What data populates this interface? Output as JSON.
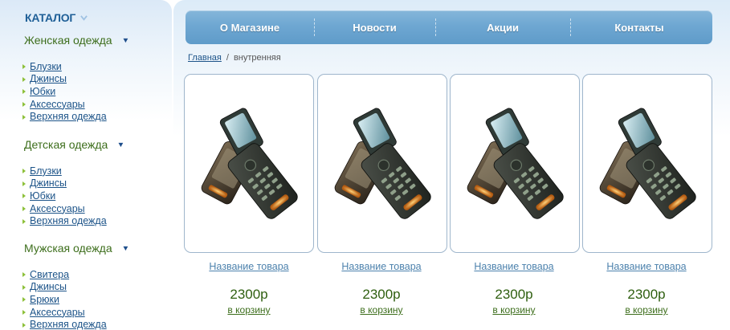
{
  "sidebar": {
    "catalog_title": "КАТАЛОГ",
    "sections": [
      {
        "title": "Женская одежда",
        "items": [
          "Блузки",
          "Джинсы",
          "Юбки",
          "Аксессуары",
          "Верхняя одежда"
        ]
      },
      {
        "title": "Детская одежда",
        "items": [
          "Блузки",
          "Джинсы",
          "Юбки",
          "Аксессуары",
          "Верхняя одежда"
        ]
      },
      {
        "title": "Мужская одежда",
        "items": [
          "Свитера",
          "Джинсы",
          "Брюки",
          "Аксессуары",
          "Верхняя одежда"
        ]
      }
    ]
  },
  "nav": {
    "items": [
      "О Магазине",
      "Новости",
      "Акции",
      "Контакты"
    ]
  },
  "breadcrumb": {
    "home": "Главная",
    "separator": "/",
    "current": "внутренняя"
  },
  "products": [
    {
      "name": "Название товара",
      "price": "2300р",
      "cart": "в корзину",
      "icon": "flip-phone-image"
    },
    {
      "name": "Название товара",
      "price": "2300р",
      "cart": "в корзину",
      "icon": "flip-phone-image"
    },
    {
      "name": "Название товара",
      "price": "2300р",
      "cart": "в корзину",
      "icon": "flip-phone-image"
    },
    {
      "name": "Название товара",
      "price": "2300р",
      "cart": "в корзину",
      "icon": "flip-phone-image"
    }
  ],
  "colors": {
    "brand_blue": "#1f5f97",
    "nav_blue": "#6ea7d2",
    "section_green": "#3d6e1c",
    "price_green": "#2f5f10",
    "link_blue": "#1d5489",
    "bullet_green": "#8dc03a"
  }
}
